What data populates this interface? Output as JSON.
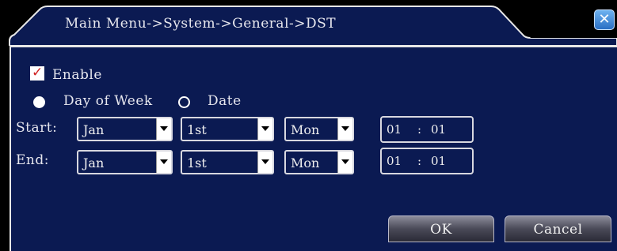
{
  "window": {
    "title": "Main Menu->System->General->DST",
    "close_label": "✕"
  },
  "enable": {
    "label": "Enable",
    "checked": true
  },
  "mode": {
    "day_of_week_label": "Day of Week",
    "date_label": "Date",
    "selected": "Day of Week"
  },
  "start": {
    "label": "Start:",
    "month": "Jan",
    "week": "1st",
    "day": "Mon",
    "hour": "01",
    "separator": ":",
    "minute": "01"
  },
  "end": {
    "label": "End:",
    "month": "Jan",
    "week": "1st",
    "day": "Mon",
    "hour": "01",
    "separator": ":",
    "minute": "01"
  },
  "buttons": {
    "ok": "OK",
    "cancel": "Cancel"
  },
  "colors": {
    "panel": "#0b1a52",
    "background": "#000000",
    "close_button": "#2a6fc4",
    "checkmark": "#d02020"
  }
}
